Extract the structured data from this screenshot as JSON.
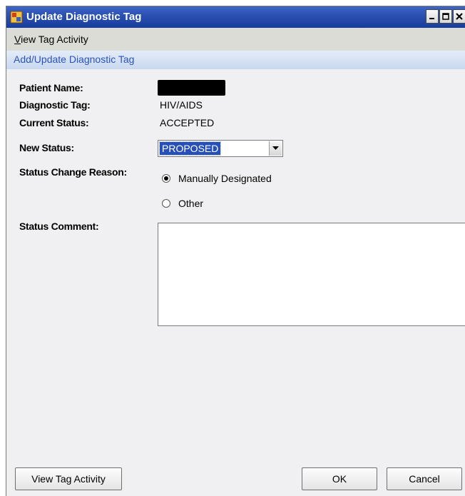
{
  "window": {
    "title": "Update Diagnostic Tag",
    "controls": {
      "minimize": "_",
      "maximize": "□",
      "close": "×"
    }
  },
  "menu": {
    "view_tag_activity_underlined": "V",
    "view_tag_activity_rest": "iew Tag Activity"
  },
  "section": {
    "title": "Add/Update Diagnostic Tag"
  },
  "form": {
    "patient_name_label": "Patient Name:",
    "diagnostic_tag_label": "Diagnostic Tag:",
    "diagnostic_tag_value": "HIV/AIDS",
    "current_status_label": "Current Status:",
    "current_status_value": "ACCEPTED",
    "new_status_label": "New Status:",
    "new_status_value": "PROPOSED",
    "status_change_reason_label": "Status Change Reason:",
    "reason_options": [
      {
        "label": "Manually Designated",
        "checked": true
      },
      {
        "label": "Other",
        "checked": false
      }
    ],
    "status_comment_label": "Status Comment:",
    "status_comment_value": ""
  },
  "buttons": {
    "view_tag_activity": "View Tag Activity",
    "ok": "OK",
    "cancel": "Cancel"
  },
  "colors": {
    "title_bar": "#2a4fb0",
    "section_title_text": "#2b52b8",
    "selection_highlight": "#2650b8"
  }
}
